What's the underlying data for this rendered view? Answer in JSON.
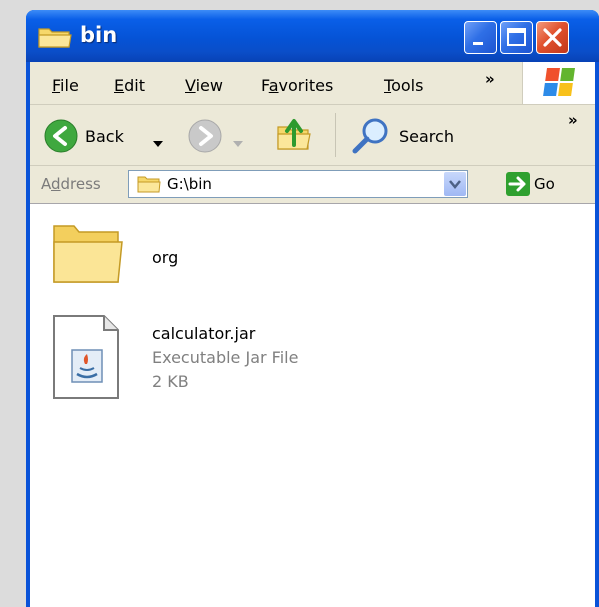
{
  "window": {
    "title": "bin"
  },
  "menu": {
    "items": [
      "File",
      "Edit",
      "View",
      "Favorites",
      "Tools"
    ],
    "overflow": "»"
  },
  "toolbar": {
    "back_label": "Back",
    "search_label": "Search",
    "overflow": "»"
  },
  "address": {
    "label": "Address",
    "path": "G:\\bin",
    "go_label": "Go"
  },
  "files": [
    {
      "name": "org",
      "icon": "folder-icon"
    },
    {
      "name": "calculator.jar",
      "type": "Executable Jar File",
      "size": "2 KB",
      "icon": "jar-file-icon"
    }
  ],
  "colors": {
    "titlebar": "#0553d6",
    "chrome": "#ece9d8",
    "go_green": "#2fa02f",
    "close_red": "#e1522e"
  }
}
